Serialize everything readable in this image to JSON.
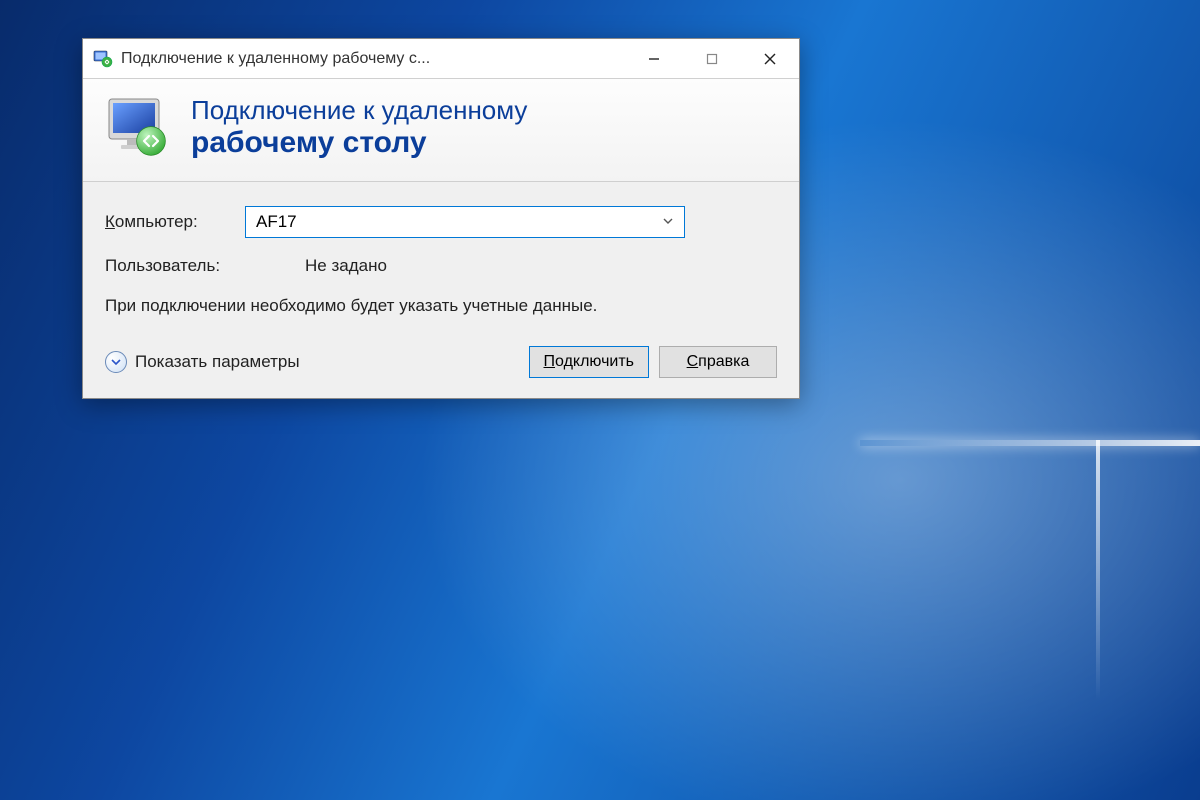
{
  "window": {
    "title": "Подключение к удаленному рабочему с..."
  },
  "banner": {
    "line1": "Подключение к удаленному",
    "line2": "рабочему столу"
  },
  "form": {
    "computer_label": "Компьютер:",
    "computer_label_ul": "К",
    "computer_value": "AF17",
    "user_label": "Пользователь:",
    "user_value": "Не задано",
    "hint": "При подключении необходимо будет указать учетные данные."
  },
  "footer": {
    "show_options": "Показать параметры",
    "show_options_ul": "П",
    "connect": "Подключить",
    "connect_ul": "П",
    "help": "Справка",
    "help_ul": "С"
  }
}
